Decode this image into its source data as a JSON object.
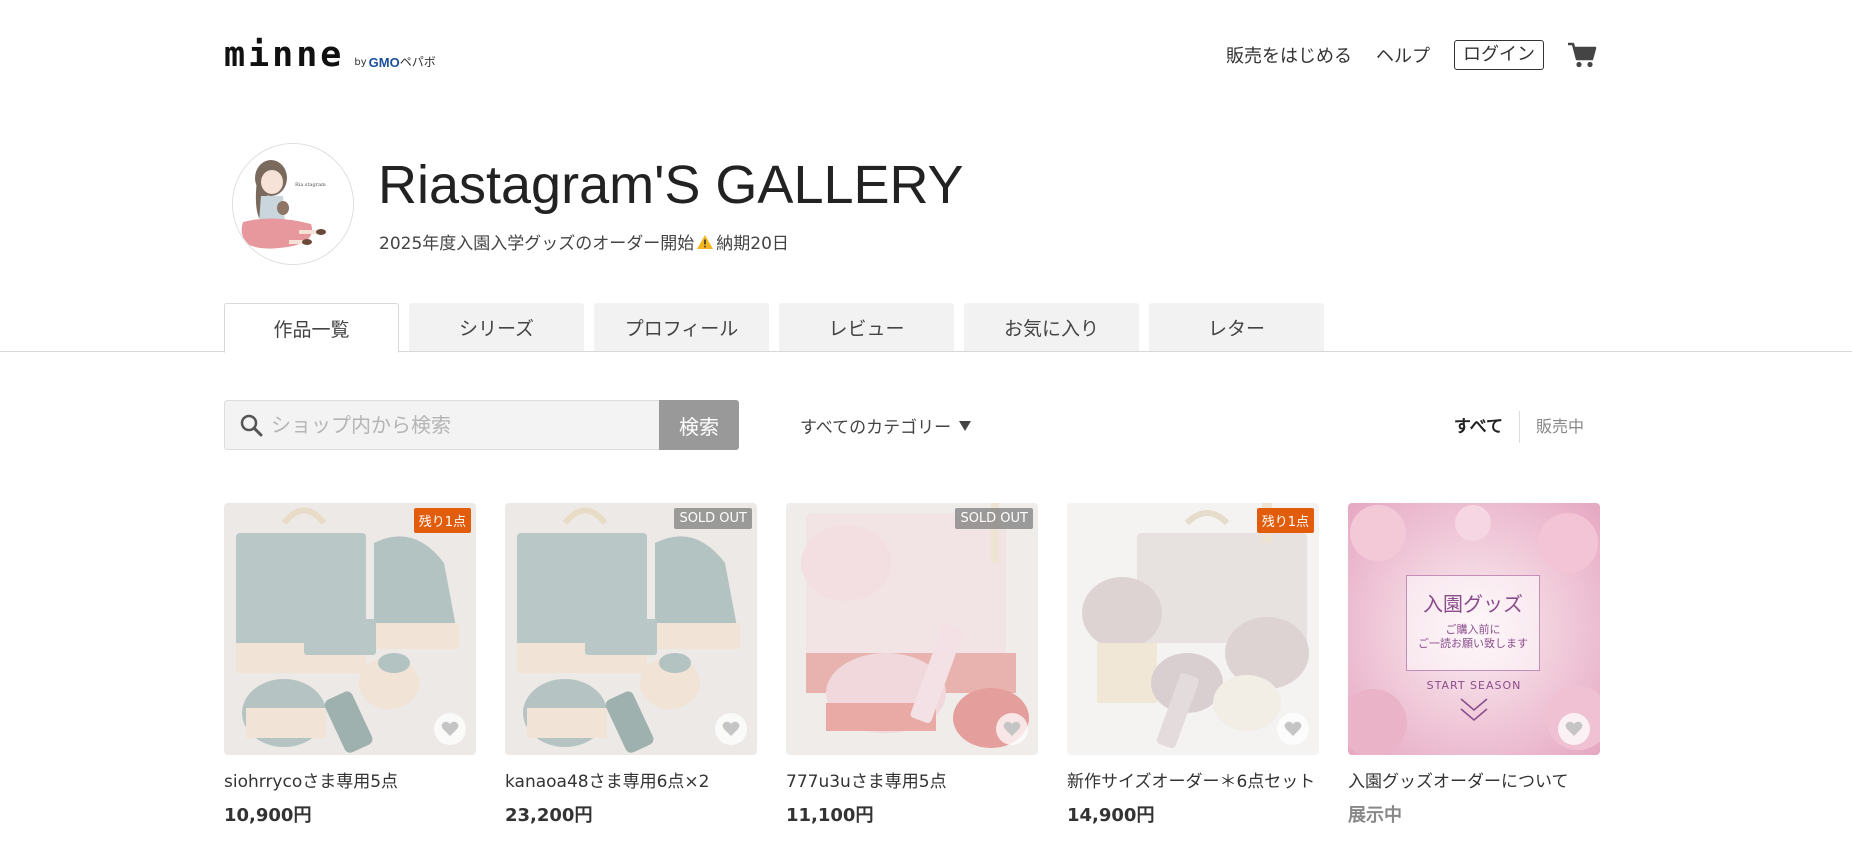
{
  "header": {
    "logo_text": "minne",
    "logo_by": "by",
    "logo_gmo": "GMO",
    "logo_pepabo": "ペパボ",
    "nav": {
      "start_selling": "販売をはじめる",
      "help": "ヘルプ",
      "login": "ログイン"
    },
    "cart_icon": "cart-icon"
  },
  "shop": {
    "name": "Riastagram'S GALLERY",
    "description_before": "2025年度入園入学グッズのオーダー開始",
    "description_icon": "warning-icon",
    "description_after": "納期20日"
  },
  "tabs": [
    {
      "label": "作品一覧",
      "active": true
    },
    {
      "label": "シリーズ",
      "active": false
    },
    {
      "label": "プロフィール",
      "active": false
    },
    {
      "label": "レビュー",
      "active": false
    },
    {
      "label": "お気に入り",
      "active": false
    },
    {
      "label": "レター",
      "active": false
    }
  ],
  "search": {
    "placeholder": "ショップ内から検索",
    "button": "検索",
    "category": "すべてのカテゴリー",
    "filter_all": "すべて",
    "filter_on_sale": "販売中"
  },
  "items": [
    {
      "title": "siohrrycoさま専用5点",
      "price": "10,900円",
      "badge": "残り1点",
      "badge_color": "#e15c0b"
    },
    {
      "title": "kanaoa48さま専用6点×2",
      "price": "23,200円",
      "badge": "SOLD OUT",
      "badge_color": "#787878"
    },
    {
      "title": "777u3uさま専用5点",
      "price": "11,100円",
      "badge": "SOLD OUT",
      "badge_color": "#787878"
    },
    {
      "title": "新作サイズオーダー＊6点セット",
      "price": "14,900円",
      "badge": "残り1点",
      "badge_color": "#e15c0b"
    },
    {
      "title": "入園グッズオーダーについて",
      "price": "展示中",
      "badge": "",
      "badge_color": "",
      "card_text": {
        "title": "入園グッズ",
        "line1": "ご購入前に",
        "line2": "ご一読お願い致します",
        "season": "START SEASON"
      }
    }
  ]
}
